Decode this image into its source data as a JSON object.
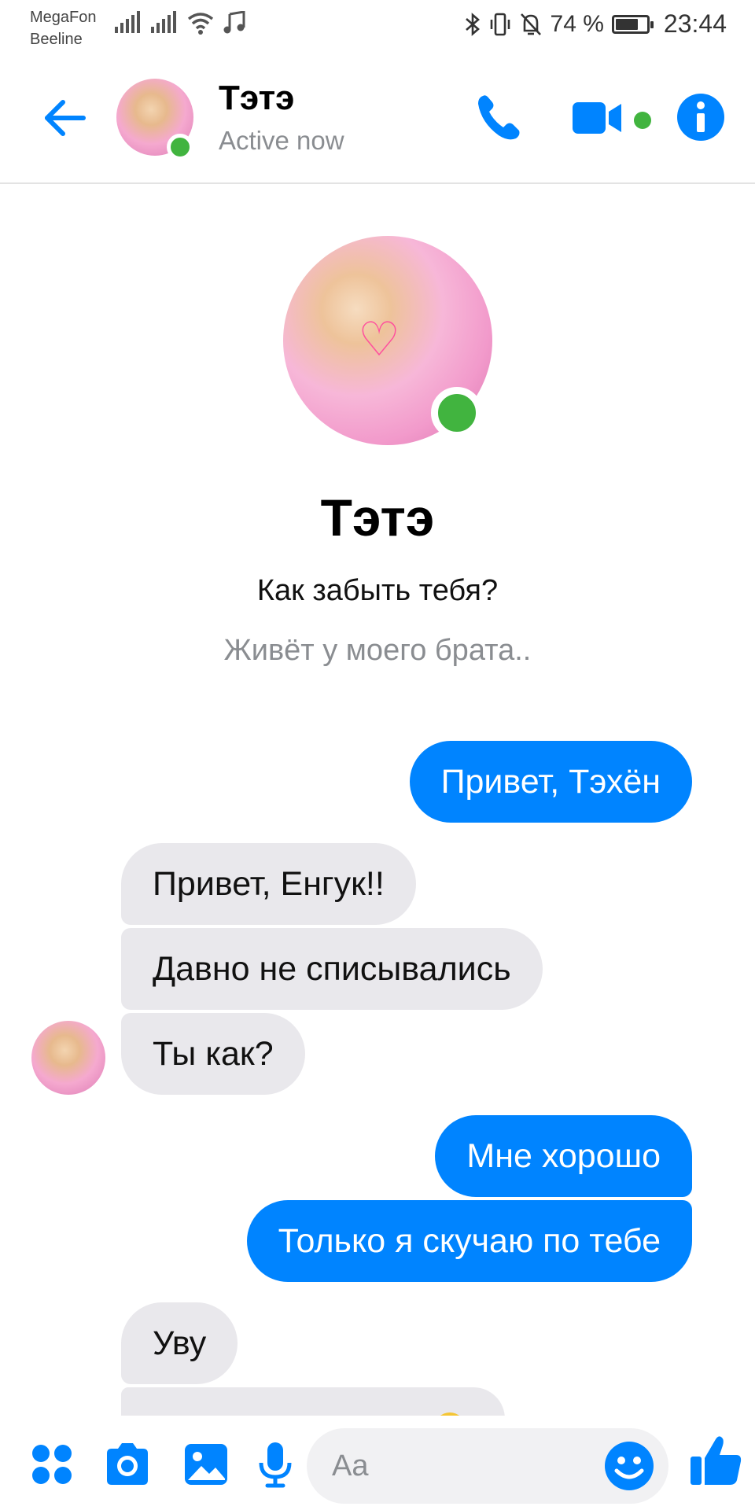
{
  "status_bar": {
    "carrier_1": "MegaFon",
    "carrier_2": "Beeline",
    "battery_percent": "74 %",
    "battery_level": 0.74,
    "time": "23:44"
  },
  "header": {
    "contact_name": "Тэтэ",
    "presence": "Active now",
    "icons": [
      "back-arrow-icon",
      "phone-icon",
      "video-camera-icon",
      "info-icon"
    ]
  },
  "profile": {
    "name": "Тэтэ",
    "line1": "Как забыть тебя?",
    "line2": "Живёт у моего брата.."
  },
  "messages": [
    {
      "direction": "out",
      "text": "Привет, Тэхён"
    },
    {
      "direction": "in",
      "text": "Привет, Енгук!!"
    },
    {
      "direction": "in",
      "text": "Давно не списывались"
    },
    {
      "direction": "in",
      "text": "Ты как?"
    },
    {
      "direction": "out",
      "text": "Мне хорошо"
    },
    {
      "direction": "out",
      "text": "Только я скучаю по тебе"
    },
    {
      "direction": "in",
      "text": "Уву"
    }
  ],
  "composer": {
    "placeholder": "Aa",
    "icons": [
      "more-apps-icon",
      "camera-icon",
      "gallery-icon",
      "microphone-icon",
      "emoji-icon",
      "thumbs-up-icon"
    ]
  },
  "colors": {
    "accent": "#0084ff",
    "online": "#41b43f",
    "incoming_bubble": "#e9e8ec",
    "muted_text": "#8a8d91"
  }
}
